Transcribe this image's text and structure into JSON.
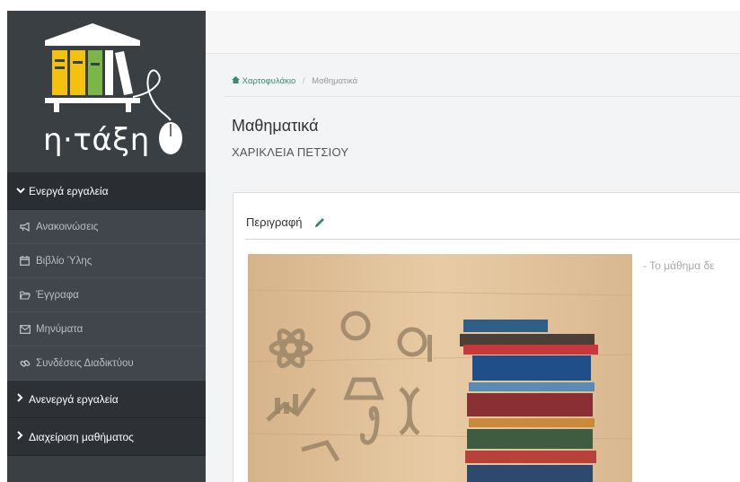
{
  "logo": {
    "text": "η·τάξη"
  },
  "sidebar": {
    "active_section": "Ενεργά εργαλεία",
    "items": [
      {
        "label": "Ανακοινώσεις",
        "icon": "bullhorn-icon"
      },
      {
        "label": "Βιβλίο Ύλης",
        "icon": "calendar-icon"
      },
      {
        "label": "Έγγραφα",
        "icon": "folder-icon"
      },
      {
        "label": "Μηνύματα",
        "icon": "envelope-icon"
      },
      {
        "label": "Συνδέσεις Διαδικτύου",
        "icon": "link-icon"
      }
    ],
    "inactive_section": "Ανενεργά εργαλεία",
    "admin_section": "Διαχείριση μαθήματος"
  },
  "breadcrumb": {
    "home": "Χαρτοφυλάκιο",
    "current": "Μαθηματικά"
  },
  "course": {
    "title": "Μαθηματικά",
    "teacher": "ΧΑΡΙΚΛΕΙΑ ΠΕΤΣΙΟΥ"
  },
  "panel": {
    "heading": "Περιγραφή",
    "description": "- Το μάθημα δε"
  },
  "colors": {
    "sidebar": "#3a3f44",
    "accent": "#3c8a6c",
    "logo_yellow": "#f2c20f",
    "logo_green": "#7ab648"
  }
}
